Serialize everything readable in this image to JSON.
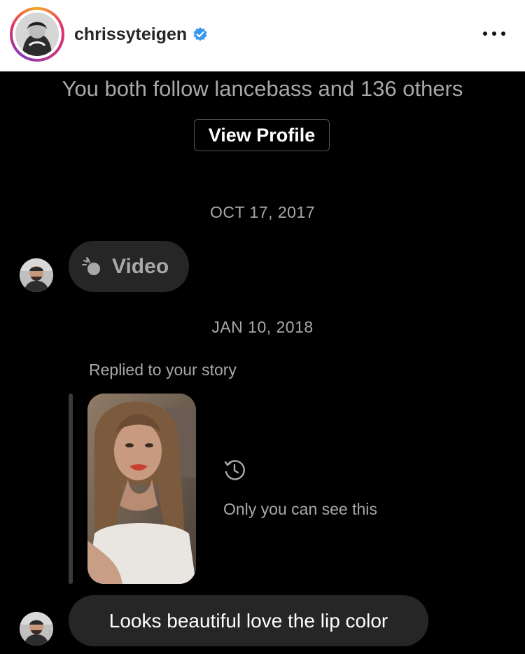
{
  "header": {
    "username": "chrissyteigen",
    "verified_icon": "verified-badge-icon",
    "more_icon": "more-options-icon",
    "avatar_icon": "profile-avatar",
    "background_color": "#ffffff",
    "accent_color": "#3897f0"
  },
  "intro": {
    "follow_text": "You both follow lancebass and 136 others",
    "view_profile_label": "View Profile"
  },
  "thread": {
    "dates": [
      "OCT 17, 2017",
      "JAN 10, 2018"
    ],
    "video_message": {
      "label": "Video",
      "icon": "video-sparkle-icon"
    },
    "story_reply": {
      "replied_label": "Replied to your story",
      "privacy_icon": "history-icon",
      "privacy_text": "Only you can see this"
    },
    "text_message": {
      "text": "Looks beautiful love the lip color"
    }
  },
  "colors": {
    "background": "#000000",
    "bubble": "#262626",
    "muted_text": "#a8a8a8",
    "primary_text": "#ffffff"
  }
}
